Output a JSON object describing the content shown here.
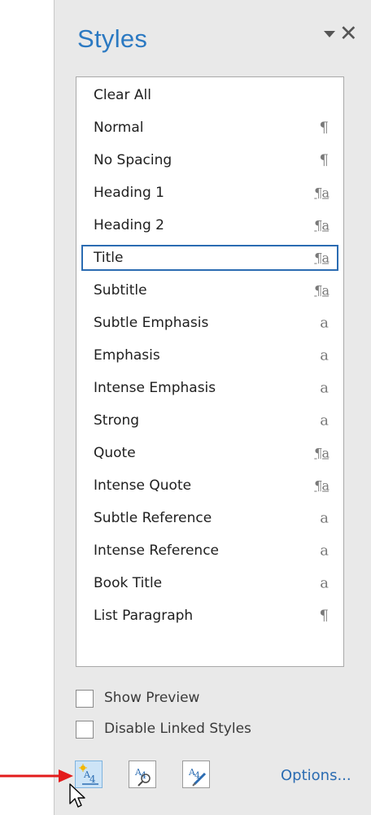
{
  "pane": {
    "title": "Styles",
    "close_glyph": "✕",
    "accent_color": "#2b79c2"
  },
  "styles": [
    {
      "name": "Clear All",
      "glyph": ""
    },
    {
      "name": "Normal",
      "glyph": "¶"
    },
    {
      "name": "No Spacing",
      "glyph": "¶"
    },
    {
      "name": "Heading 1",
      "glyph": "¶a"
    },
    {
      "name": "Heading 2",
      "glyph": "¶a"
    },
    {
      "name": "Title",
      "glyph": "¶a"
    },
    {
      "name": "Subtitle",
      "glyph": "¶a"
    },
    {
      "name": "Subtle Emphasis",
      "glyph": "a"
    },
    {
      "name": "Emphasis",
      "glyph": "a"
    },
    {
      "name": "Intense Emphasis",
      "glyph": "a"
    },
    {
      "name": "Strong",
      "glyph": "a"
    },
    {
      "name": "Quote",
      "glyph": "¶a"
    },
    {
      "name": "Intense Quote",
      "glyph": "¶a"
    },
    {
      "name": "Subtle Reference",
      "glyph": "a"
    },
    {
      "name": "Intense Reference",
      "glyph": "a"
    },
    {
      "name": "Book Title",
      "glyph": "a"
    },
    {
      "name": "List Paragraph",
      "glyph": "¶"
    }
  ],
  "selected_style": "Title",
  "checkboxes": {
    "show_preview": {
      "label": "Show Preview",
      "checked": false
    },
    "disable_linked": {
      "label": "Disable Linked Styles",
      "checked": false
    }
  },
  "toolbar": {
    "new_style_icon": "new-style-icon",
    "style_inspector_icon": "style-inspector-icon",
    "manage_styles_icon": "manage-styles-icon",
    "options_label": "Options..."
  },
  "annotation_color": "#e31b1b"
}
